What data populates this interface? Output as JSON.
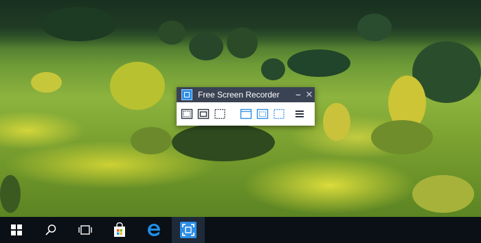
{
  "recorder": {
    "title": "Free Screen Recorder",
    "logo_icon": "screen-recorder-icon",
    "controls": {
      "minimize": "–",
      "close": "✕"
    },
    "tools": [
      {
        "name": "record-fullscreen-icon"
      },
      {
        "name": "record-window-icon"
      },
      {
        "name": "record-region-icon"
      },
      {
        "name": "screenshot-fullscreen-icon"
      },
      {
        "name": "screenshot-window-icon"
      },
      {
        "name": "screenshot-region-icon"
      },
      {
        "name": "menu-icon"
      }
    ]
  },
  "taskbar": {
    "items": [
      {
        "name": "windows-start-icon"
      },
      {
        "name": "search-icon"
      },
      {
        "name": "task-view-icon"
      },
      {
        "name": "store-icon"
      },
      {
        "name": "edge-icon"
      },
      {
        "name": "screen-recorder-app-icon",
        "active": true
      }
    ]
  },
  "colors": {
    "titlebar": "#3a4353",
    "accent": "#2e8ee6",
    "taskbar": "#0b0f16"
  }
}
